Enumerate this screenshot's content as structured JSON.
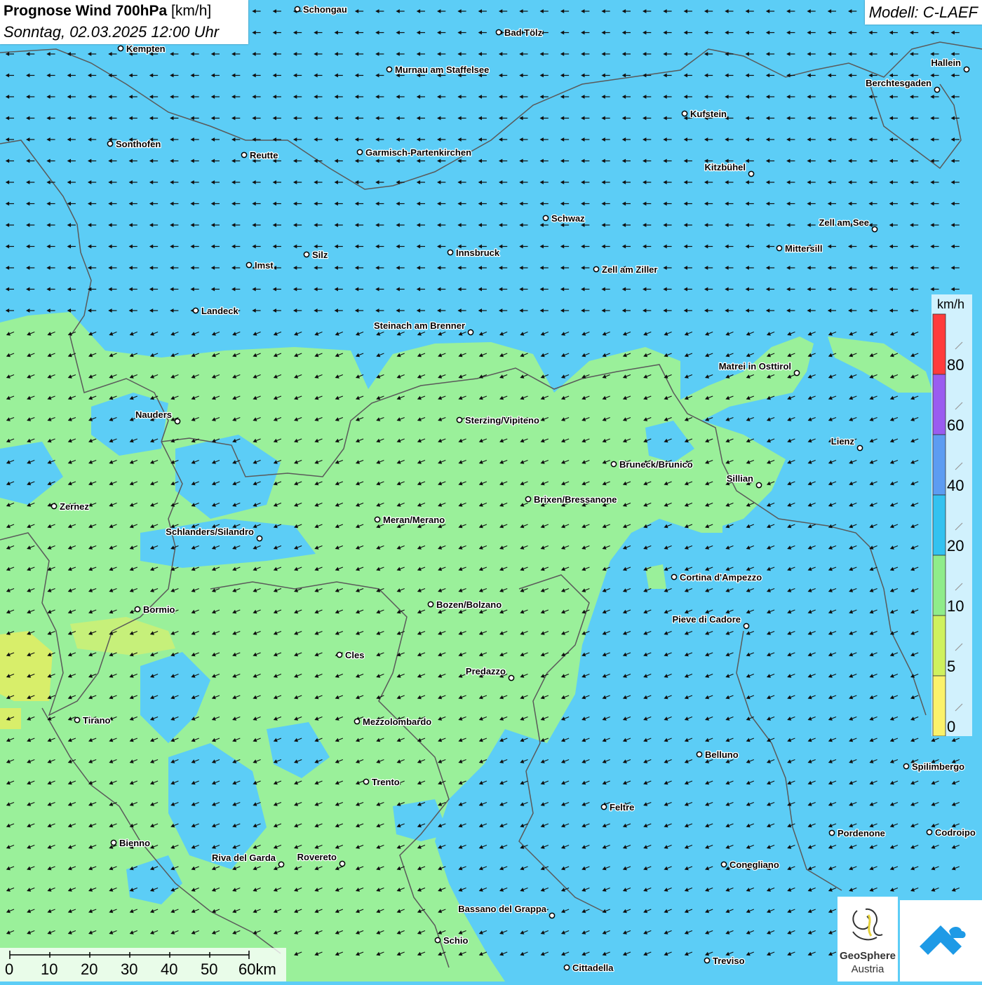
{
  "header": {
    "title": "Prognose Wind 700hPa",
    "unit": "[km/h]",
    "datetime": "Sonntag, 02.03.2025 12:00 Uhr",
    "model": "Modell: C-LAEF"
  },
  "legend": {
    "unit": "km/h",
    "levels": [
      {
        "label": "80",
        "color": "#ff3b3b"
      },
      {
        "label": "60",
        "color": "#9a5cf0"
      },
      {
        "label": "40",
        "color": "#5c9cf2"
      },
      {
        "label": "20",
        "color": "#33c2f0"
      },
      {
        "label": "10",
        "color": "#8fec8a"
      },
      {
        "label": "5",
        "color": "#cff15e"
      },
      {
        "label": "0",
        "color": "#fbf26a"
      }
    ]
  },
  "scale_bar": {
    "labels": [
      "0",
      "10",
      "20",
      "30",
      "40",
      "50",
      "60km"
    ]
  },
  "colors": {
    "calm_green": "#9af09a",
    "moderate_blue": "#5ccdf6",
    "light_yellow": "#d8ee6a",
    "border": "#5a5a5a",
    "arrow": "#111111"
  },
  "wind": {
    "direction": "from east-northeast",
    "speed_band_north": "20-40 km/h",
    "speed_band_central": "10-20 km/h"
  },
  "cities": [
    {
      "name": "Schongau"
    },
    {
      "name": "Bad Tölz"
    },
    {
      "name": "Kempten"
    },
    {
      "name": "Murnau am Staffelsee"
    },
    {
      "name": "Hallein"
    },
    {
      "name": "Berchtesgaden"
    },
    {
      "name": "Kufstein"
    },
    {
      "name": "Sonthofen"
    },
    {
      "name": "Reutte"
    },
    {
      "name": "Garmisch-Partenkirchen"
    },
    {
      "name": "Kitzbühel"
    },
    {
      "name": "Schwaz"
    },
    {
      "name": "Zell am See"
    },
    {
      "name": "Mittersill"
    },
    {
      "name": "Innsbruck"
    },
    {
      "name": "Silz"
    },
    {
      "name": "Imst"
    },
    {
      "name": "Zell am Ziller"
    },
    {
      "name": "Landeck"
    },
    {
      "name": "Steinach am Brenner"
    },
    {
      "name": "Matrei in Osttirol"
    },
    {
      "name": "Nauders"
    },
    {
      "name": "Sterzing/Vipiteno"
    },
    {
      "name": "Lienz"
    },
    {
      "name": "Bruneck/Brunico"
    },
    {
      "name": "Sillian"
    },
    {
      "name": "Brixen/Bressanone"
    },
    {
      "name": "Zernez"
    },
    {
      "name": "Meran/Merano"
    },
    {
      "name": "Schlanders/Silandro"
    },
    {
      "name": "Cortina d'Ampezzo"
    },
    {
      "name": "Bozen/Bolzano"
    },
    {
      "name": "Bormio"
    },
    {
      "name": "Pieve di Cadore"
    },
    {
      "name": "Cles"
    },
    {
      "name": "Predazzo"
    },
    {
      "name": "Tirano"
    },
    {
      "name": "Mezzolombardo"
    },
    {
      "name": "Belluno"
    },
    {
      "name": "Spilimbergo"
    },
    {
      "name": "Trento"
    },
    {
      "name": "Feltre"
    },
    {
      "name": "Pordenone"
    },
    {
      "name": "Codroipo"
    },
    {
      "name": "Bienno"
    },
    {
      "name": "Riva del Garda"
    },
    {
      "name": "Rovereto"
    },
    {
      "name": "Conegliano"
    },
    {
      "name": "Bassano del Grappa"
    },
    {
      "name": "Schio"
    },
    {
      "name": "Treviso"
    },
    {
      "name": "Cittadella"
    }
  ],
  "logo": {
    "name_line1": "GeoSphere",
    "name_line2": "Austria"
  }
}
